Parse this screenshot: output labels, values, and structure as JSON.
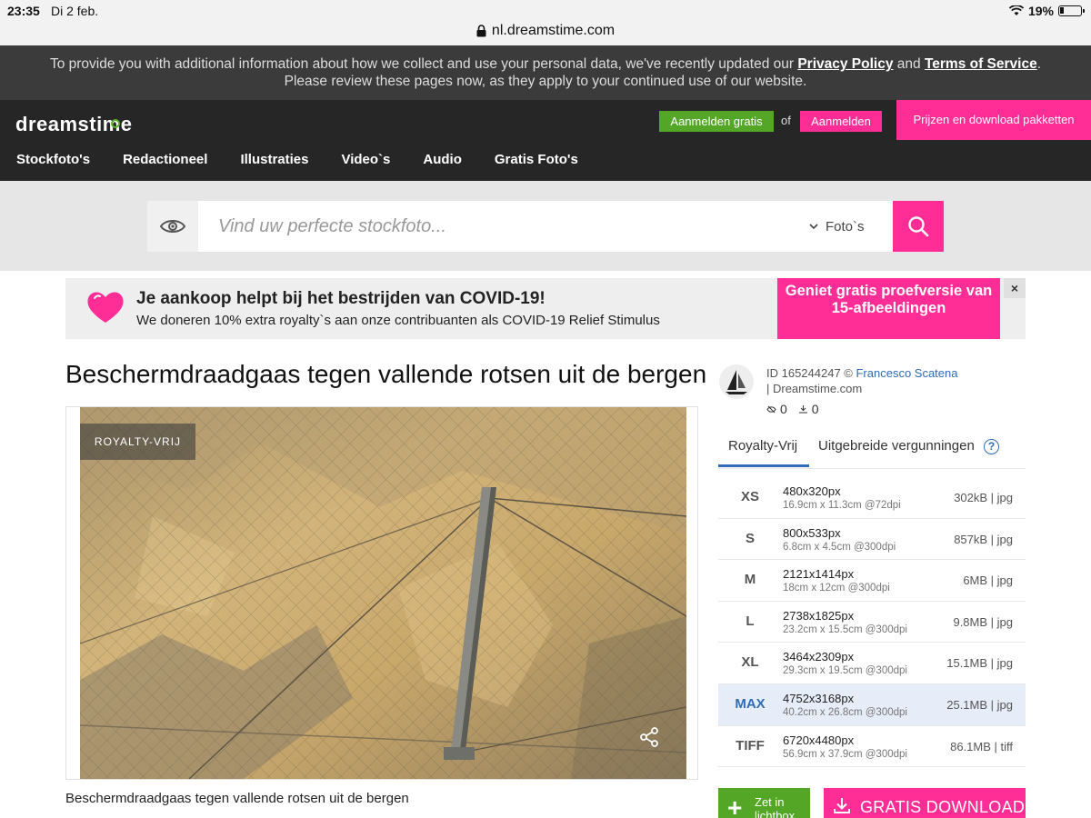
{
  "status": {
    "time": "23:35",
    "date": "Di 2 feb.",
    "battery": "19%"
  },
  "browser": {
    "url": "nl.dreamstime.com"
  },
  "privacy": {
    "text_1": "To provide you with additional information about how we collect and use your personal data, we've recently updated our ",
    "privacy_link": "Privacy Policy",
    "and": " and ",
    "tos_link": "Terms of Service",
    "text_2": ". Please review these pages now, as they apply to your continued use of our website."
  },
  "header": {
    "logo": "dreamstime",
    "signup_label": "Aanmelden gratis",
    "or_label": "of",
    "login_label": "Aanmelden",
    "packages_label": "Prijzen en download pakketten",
    "nav": [
      "Stockfoto's",
      "Redactioneel",
      "Illustraties",
      "Video`s",
      "Audio",
      "Gratis Foto's"
    ]
  },
  "search": {
    "placeholder": "Vind uw perfecte stockfoto...",
    "type_label": "Foto`s"
  },
  "covid": {
    "title": "Je aankoop helpt bij het bestrijden van COVID-19!",
    "subtitle": "We doneren 10% extra royalty`s aan onze contribuanten als COVID-19 Relief Stimulus",
    "cta": "Geniet gratis proefversie van 15-afbeeldingen",
    "close": "×"
  },
  "image": {
    "title": "Beschermdraadgaas tegen vallende rotsen uit de bergen",
    "badge": "ROYALTY-VRIJ",
    "caption": "Beschermdraadgaas tegen vallende rotsen uit de bergen"
  },
  "author": {
    "id_label": "ID 165244247 © ",
    "name": "Francesco Scatena",
    "source": "| Dreamstime.com",
    "views": "0",
    "downloads": "0"
  },
  "tabs": {
    "royalty_free": "Royalty-Vrij",
    "extended": "Uitgebreide vergunningen",
    "help": "?"
  },
  "sizes": [
    {
      "code": "XS",
      "px": "480x320px",
      "cm": "16.9cm x 11.3cm @72dpi",
      "file": "302kB | jpg"
    },
    {
      "code": "S",
      "px": "800x533px",
      "cm": "6.8cm x 4.5cm @300dpi",
      "file": "857kB | jpg"
    },
    {
      "code": "M",
      "px": "2121x1414px",
      "cm": "18cm x 12cm @300dpi",
      "file": "6MB | jpg"
    },
    {
      "code": "L",
      "px": "2738x1825px",
      "cm": "23.2cm x 15.5cm @300dpi",
      "file": "9.8MB | jpg"
    },
    {
      "code": "XL",
      "px": "3464x2309px",
      "cm": "29.3cm x 19.5cm @300dpi",
      "file": "15.1MB | jpg"
    },
    {
      "code": "MAX",
      "px": "4752x3168px",
      "cm": "40.2cm x 26.8cm @300dpi",
      "file": "25.1MB | jpg"
    },
    {
      "code": "TIFF",
      "px": "6720x4480px",
      "cm": "56.9cm x 37.9cm @300dpi",
      "file": "86.1MB | tiff"
    }
  ],
  "selected_size": "MAX",
  "actions": {
    "lightbox_label": "Zet in lichtbox",
    "download_label": "GRATIS DOWNLOAD"
  },
  "colors": {
    "brand_pink": "#ff2d95",
    "brand_green": "#54a627",
    "link_blue": "#2e6cb5",
    "header_dark": "#262626"
  }
}
